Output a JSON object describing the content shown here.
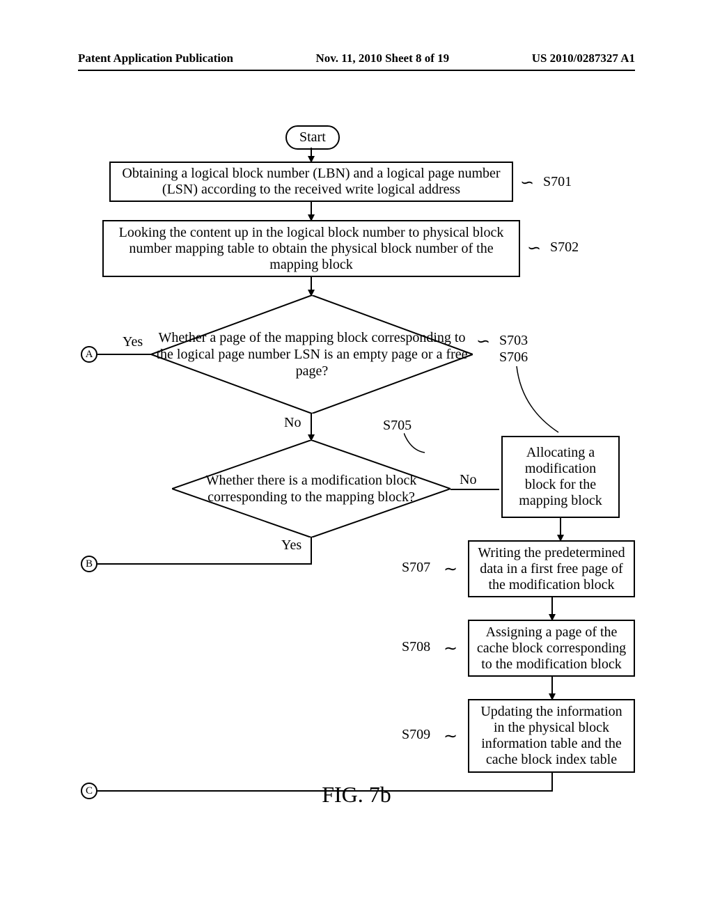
{
  "header": {
    "left": "Patent Application Publication",
    "center": "Nov. 11, 2010  Sheet 8 of 19",
    "right": "US 2010/0287327 A1"
  },
  "flowchart": {
    "start": "Start",
    "s701": {
      "text": "Obtaining a logical block number (LBN) and a logical page number (LSN) according to the received write logical address",
      "label": "S701"
    },
    "s702": {
      "text": "Looking the content up in the logical block number to physical block number mapping table to obtain the physical block number of the mapping block",
      "label": "S702"
    },
    "s703": {
      "text": "Whether a page of the mapping block corresponding to the logical page number LSN is an empty page or a free page?",
      "label": "S703",
      "yes": "Yes",
      "no": "No"
    },
    "s705": {
      "text": "Whether there is a modification block corresponding to the mapping block?",
      "label": "S705",
      "yes": "Yes",
      "no": "No"
    },
    "s706": {
      "text": "Allocating a modification block for the mapping block",
      "label": "S706"
    },
    "s707": {
      "text": "Writing the predetermined data in a first free page of the modification block",
      "label": "S707"
    },
    "s708": {
      "text": "Assigning a page of the cache block corresponding to the modification block",
      "label": "S708"
    },
    "s709": {
      "text": "Updating the information in the physical block information table and the cache block index table",
      "label": "S709"
    },
    "connectors": {
      "a": "A",
      "b": "B",
      "c": "C"
    }
  },
  "caption": "FIG. 7b"
}
